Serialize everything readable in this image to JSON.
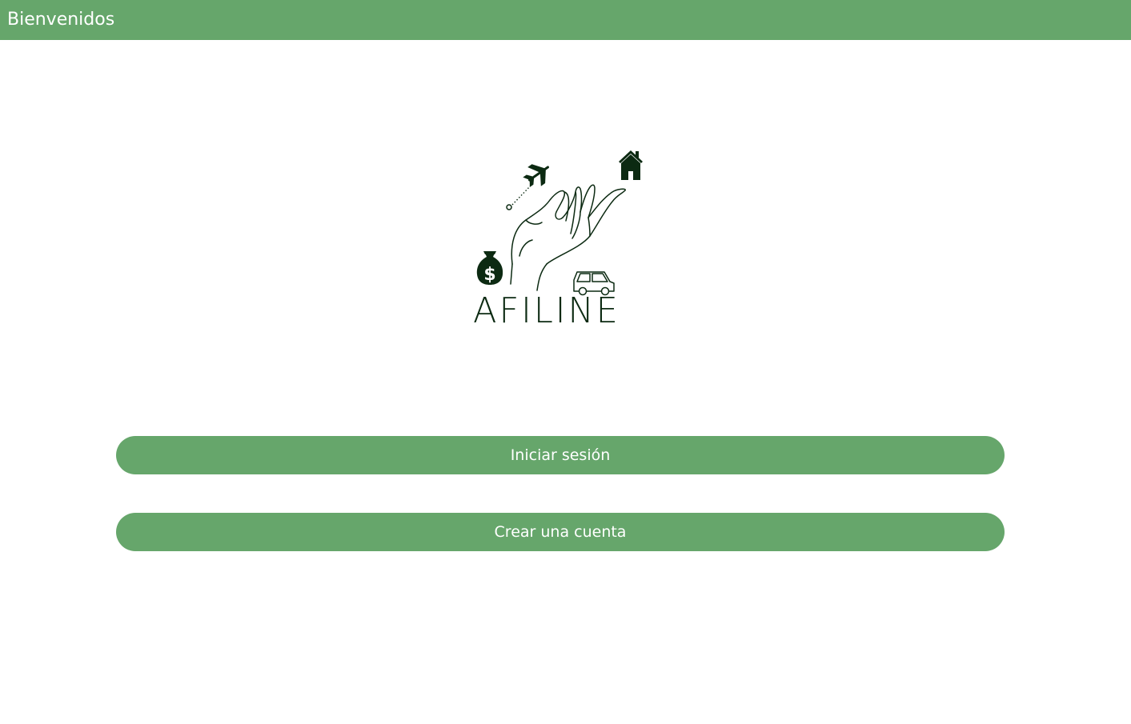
{
  "header": {
    "title": "Bienvenidos"
  },
  "logo": {
    "text": "AFILINE",
    "icons": [
      "airplane-icon",
      "house-icon",
      "money-bag-icon",
      "car-icon",
      "hand-icon"
    ],
    "color": "#0c2a12"
  },
  "actions": {
    "login_label": "Iniciar sesión",
    "register_label": "Crear una cuenta"
  },
  "colors": {
    "accent": "#66a66b",
    "background": "#ffffff",
    "button_text": "#ffffff"
  }
}
